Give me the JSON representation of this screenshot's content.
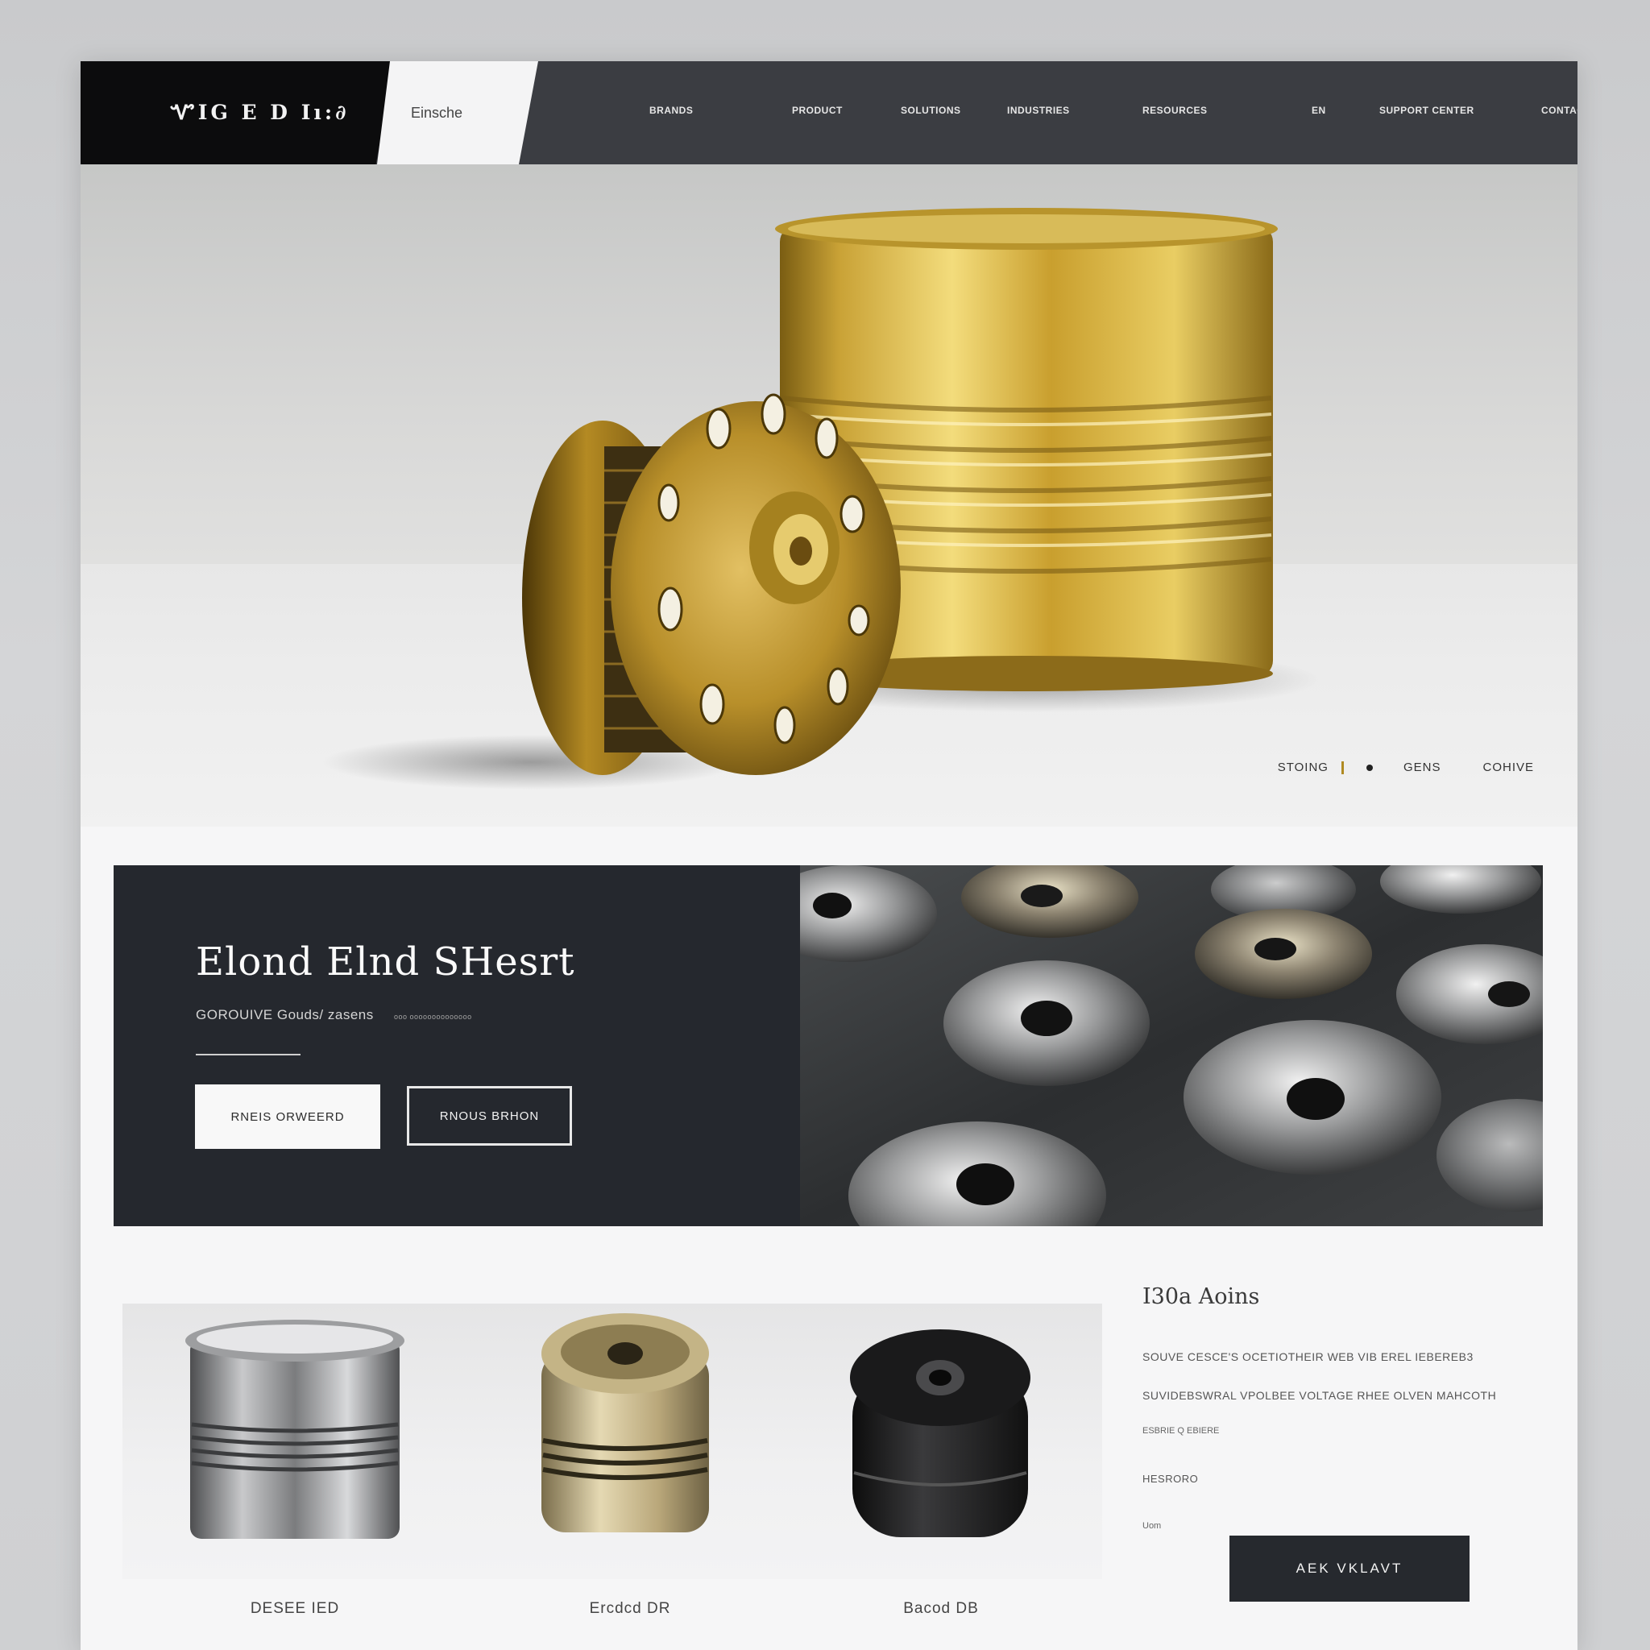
{
  "header": {
    "logo": "ᏉIG E D Iı:∂",
    "search_placeholder": "Einsche",
    "nav": [
      "BRANDS",
      "PRODUCT",
      "SOLUTIONS",
      "INDUSTRIES",
      "RESOURCES",
      "EN",
      "SUPPORT CENTER",
      "CONTACT"
    ]
  },
  "hero": {
    "links": [
      "STOING",
      "GENS",
      "COHIVE"
    ]
  },
  "featured": {
    "title": "Elond Elnd SHesrt",
    "subtitle": "GOROUIVE Gouds/ zasens",
    "subtitle_small": "ooo oooooooooooooo",
    "primary_button": "RNEIS ORWEERD",
    "secondary_button": "RNOUS BRHON"
  },
  "products": [
    {
      "label": "DESEE IED"
    },
    {
      "label": "Ercdcd DR"
    },
    {
      "label": "Bacod DB"
    }
  ],
  "sidebar": {
    "title": "I30a Aoins",
    "lines": [
      "SOUVE CESCE'S OCETIOTHEIR WEB VIB EREL IEBEREB3",
      "SUVIDEBSWRAL VPOLBEE VOLTAGE RHEE OLVEN MAHCOTH"
    ],
    "small": "ESBRIE Q EBIERE",
    "label1": "HESRORO",
    "label2": "Uom",
    "cta": "AEK VKLAVT"
  },
  "colors": {
    "header_dark": "#3b3d42",
    "logo_bg": "#0c0c0d",
    "featured_bg": "#25282e",
    "gold": "#c9a236",
    "cta_bg": "#26292e"
  }
}
